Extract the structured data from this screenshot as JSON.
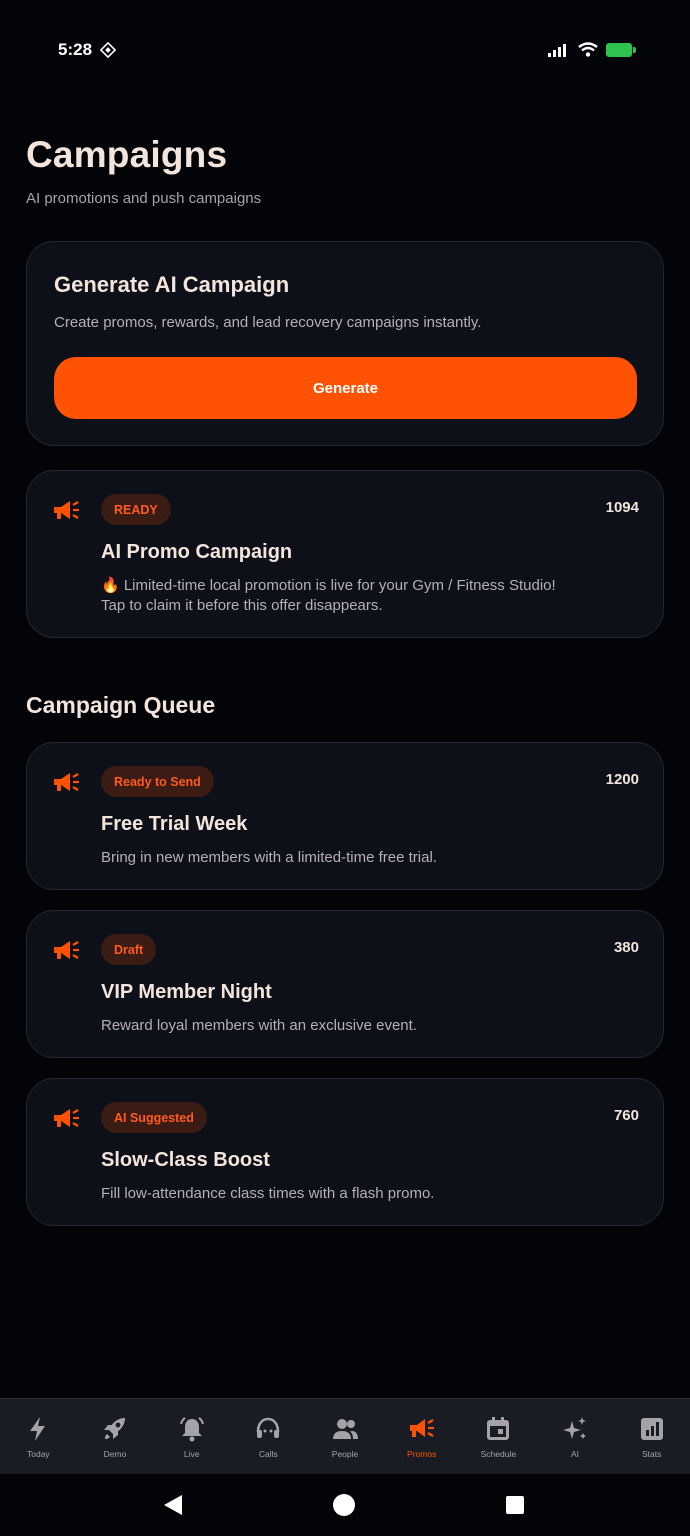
{
  "status_bar": {
    "time": "5:28"
  },
  "header": {
    "title": "Campaigns",
    "subtitle": "AI promotions and push campaigns"
  },
  "generator": {
    "title": "Generate AI Campaign",
    "description": "Create promos, rewards, and lead recovery campaigns instantly.",
    "button_label": "Generate"
  },
  "featured": {
    "badge": "READY",
    "count": "1094",
    "title": "AI Promo Campaign",
    "description": "🔥 Limited-time local promotion is live for your Gym / Fitness Studio! Tap to claim it before this offer disappears."
  },
  "queue": {
    "title": "Campaign Queue",
    "items": [
      {
        "badge": "Ready to Send",
        "count": "1200",
        "title": "Free Trial Week",
        "description": "Bring in new members with a limited-time free trial."
      },
      {
        "badge": "Draft",
        "count": "380",
        "title": "VIP Member Night",
        "description": "Reward loyal members with an exclusive event."
      },
      {
        "badge": "AI Suggested",
        "count": "760",
        "title": "Slow-Class Boost",
        "description": "Fill low-attendance class times with a flash promo."
      }
    ]
  },
  "nav": {
    "active": "Promos",
    "items": [
      {
        "label": "Today",
        "icon": "bolt-icon"
      },
      {
        "label": "Demo",
        "icon": "rocket-icon"
      },
      {
        "label": "Live",
        "icon": "bell-icon"
      },
      {
        "label": "Calls",
        "icon": "headset-icon"
      },
      {
        "label": "People",
        "icon": "people-icon"
      },
      {
        "label": "Promos",
        "icon": "megaphone-icon"
      },
      {
        "label": "Schedule",
        "icon": "calendar-icon"
      },
      {
        "label": "AI",
        "icon": "sparkles-icon"
      },
      {
        "label": "Stats",
        "icon": "bar-chart-icon"
      }
    ]
  },
  "colors": {
    "accent": "#ff5203",
    "background": "#030408",
    "card": "#0d1018",
    "badge_bg": "#3a1c14"
  }
}
